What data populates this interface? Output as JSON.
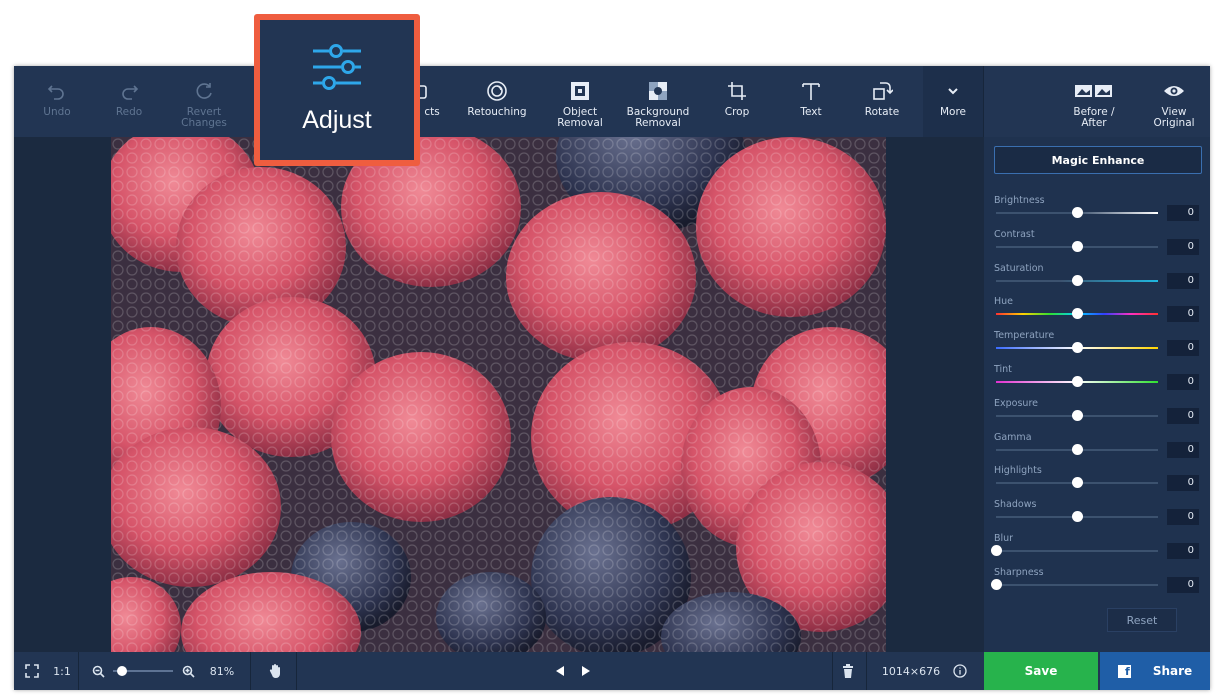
{
  "toolbar": {
    "undo_label": "Undo",
    "redo_label": "Redo",
    "revert_label": "Revert\nChanges",
    "effects_label": "cts",
    "retouching_label": "Retouching",
    "object_removal_label": "Object\nRemoval",
    "background_removal_label": "Background\nRemoval",
    "crop_label": "Crop",
    "text_label": "Text",
    "rotate_label": "Rotate",
    "more_label": "More",
    "before_after_label": "Before /\nAfter",
    "view_original_label": "View\nOriginal"
  },
  "callout": {
    "adjust_label": "Adjust",
    "border_color": "#ef5d3f"
  },
  "panel": {
    "magic_enhance_label": "Magic Enhance",
    "sliders": [
      {
        "name": "Brightness",
        "value": "0",
        "level": 0.5
      },
      {
        "name": "Contrast",
        "value": "0",
        "level": 0.5
      },
      {
        "name": "Saturation",
        "value": "0",
        "level": 0.5
      },
      {
        "name": "Hue",
        "value": "0",
        "level": 0.5
      },
      {
        "name": "Temperature",
        "value": "0",
        "level": 0.5
      },
      {
        "name": "Tint",
        "value": "0",
        "level": 0.5
      },
      {
        "name": "Exposure",
        "value": "0",
        "level": 0.5
      },
      {
        "name": "Gamma",
        "value": "0",
        "level": 0.5
      },
      {
        "name": "Highlights",
        "value": "0",
        "level": 0.5
      },
      {
        "name": "Shadows",
        "value": "0",
        "level": 0.5
      },
      {
        "name": "Blur",
        "value": "0",
        "level": 0
      },
      {
        "name": "Sharpness",
        "value": "0",
        "level": 0
      }
    ],
    "reset_label": "Reset"
  },
  "bottom": {
    "actual_size_label": "1:1",
    "zoom_value": "81%",
    "zoom_level": 0.15,
    "image_size": "1014×676",
    "save_label": "Save",
    "share_label": "Share"
  },
  "colors": {
    "accent": "#ef5d3f",
    "save": "#27b34c",
    "share": "#1f5ea7",
    "toolbar": "#223553"
  }
}
